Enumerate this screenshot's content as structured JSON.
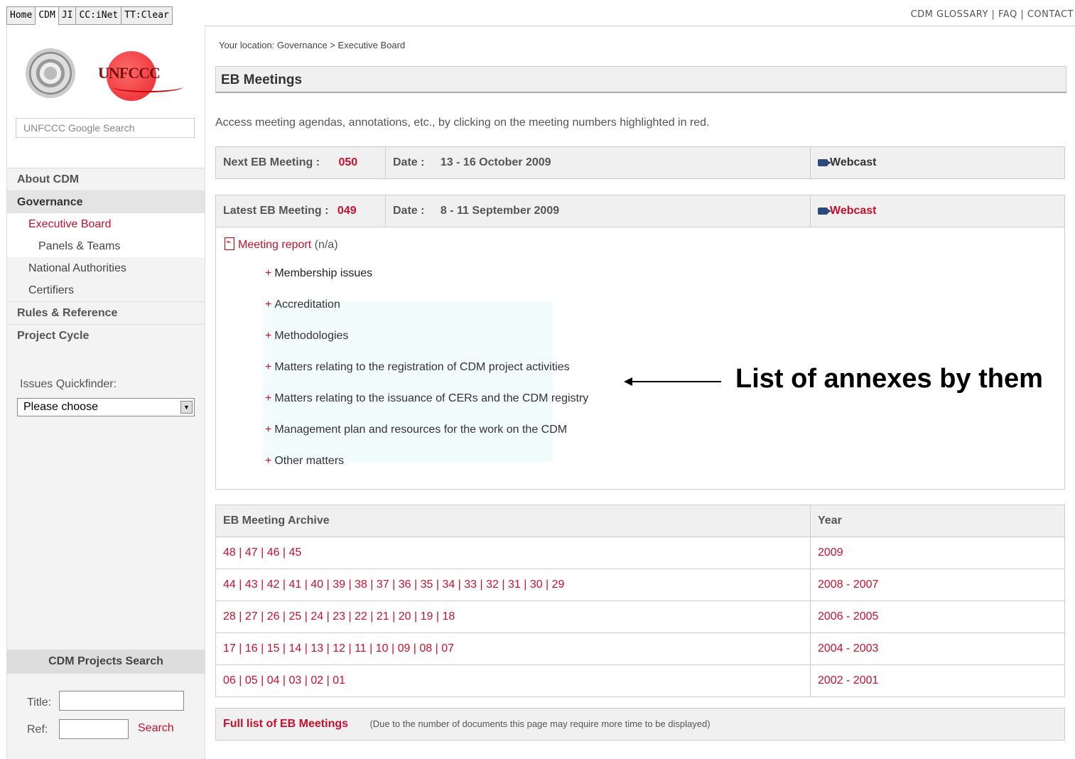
{
  "topbar": {
    "tabs": [
      "Home",
      "CDM",
      "JI",
      "CC:iNet",
      "TT:Clear"
    ],
    "links": "CDM GLOSSARY | FAQ | CONTACT"
  },
  "sidebar": {
    "logo_text": "UNFCCC",
    "search_placeholder": "UNFCCC Google Search",
    "nav": {
      "about": "About CDM",
      "governance": "Governance",
      "executive_board": "Executive Board",
      "panels": "Panels & Teams",
      "national": "National Authorities",
      "certifiers": "Certifiers",
      "rules": "Rules & Reference",
      "project_cycle": "Project Cycle"
    },
    "quickfinder_label": "Issues Quickfinder:",
    "quickfinder_value": "Please choose",
    "projects_search": {
      "heading": "CDM Projects Search",
      "title_label": "Title:",
      "ref_label": "Ref:",
      "search_label": "Search"
    }
  },
  "main": {
    "breadcrumb": "Your location: Governance > Executive Board",
    "title": "EB Meetings",
    "intro": "Access meeting agendas, annotations, etc., by clicking on the meeting numbers highlighted in red.",
    "next": {
      "label": "Next EB Meeting :",
      "number": "050",
      "date_label": "Date :",
      "date": "13 - 16 October 2009",
      "webcast": "Webcast"
    },
    "latest": {
      "label": "Latest EB Meeting :",
      "number": "049",
      "date_label": "Date :",
      "date": "8 - 11 September 2009",
      "webcast": "Webcast",
      "report_link": "Meeting report",
      "report_note": "(n/a)",
      "annexes": [
        "Membership issues",
        "Accreditation",
        "Methodologies",
        "Matters relating to the registration of CDM project activities",
        "Matters relating to the issuance of CERs and the CDM registry",
        "Management plan and resources for the work on the CDM",
        "Other matters"
      ]
    },
    "archive": {
      "header": "EB Meeting Archive",
      "year_header": "Year",
      "rows": [
        {
          "meetings": "48 | 47 | 46 | 45",
          "year": "2009"
        },
        {
          "meetings": "44 | 43 | 42 | 41 | 40 | 39 | 38 | 37 | 36 | 35 | 34 | 33 | 32 | 31 | 30 | 29",
          "year": "2008 - 2007"
        },
        {
          "meetings": "28 | 27 | 26 | 25 | 24 | 23 | 22 | 21 | 20 | 19 | 18",
          "year": "2006 - 2005"
        },
        {
          "meetings": "17 | 16 | 15 | 14 | 13 | 12 | 11 | 10 | 09 | 08 | 07",
          "year": "2004 - 2003"
        },
        {
          "meetings": "06 | 05 | 04 | 03 | 02 | 01",
          "year": "2002 - 2001"
        }
      ]
    },
    "full_list": {
      "link": "Full list of EB Meetings",
      "note": "(Due to the number of documents this page may require more time to be displayed)"
    }
  },
  "callout": "List of annexes by them"
}
